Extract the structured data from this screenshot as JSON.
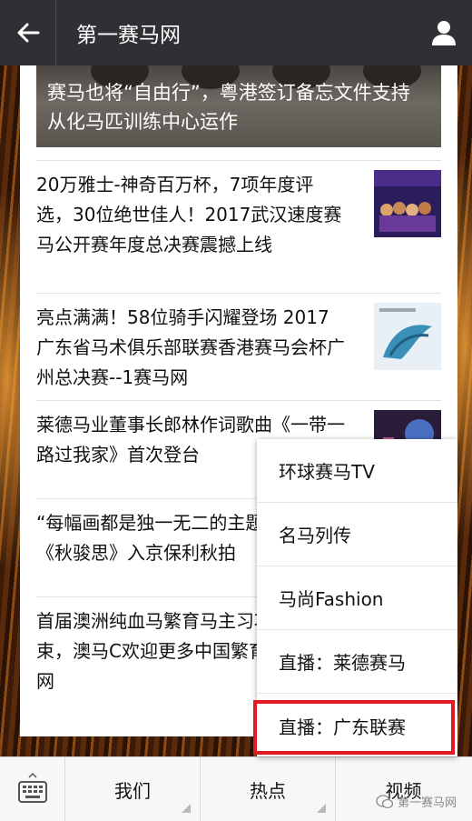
{
  "header": {
    "title": "第一赛马网"
  },
  "banner": {
    "caption": "赛马也将“自由行”，粤港签订备忘文件支持从化马匹训练中心运作"
  },
  "articles": [
    {
      "title": "20万雅士-神奇百万杯，7项年度评选，30位绝世佳人！2017武汉速度赛马公开赛年度总决赛震撼上线"
    },
    {
      "title": "亮点满满！58位骑手闪耀登场 2017广东省马术俱乐部联赛香港赛马会杯广州总决赛--1赛马网"
    },
    {
      "title": "莱德马业董事长郎林作词歌曲《一带一路过我家》首次登台"
    },
    {
      "title": "“每幅画都是独一无二的主题毛皮画《秋骏思》入京保利秋拍"
    },
    {
      "title": "首届澳洲纯血马繁育马主习项目圆满结束，澳马C欢迎更多中国繁育马主参马网"
    }
  ],
  "popup_menu": {
    "items": [
      "环球赛马TV",
      "名马列传",
      "马尚Fashion",
      "直播：莱德赛马",
      "直播：广东联赛"
    ]
  },
  "bottom_menu": {
    "items": [
      "我们",
      "热点",
      "视频"
    ]
  },
  "watermark": {
    "text": "第一赛马网"
  },
  "icons": {
    "back": "back-arrow-icon",
    "profile": "person-icon",
    "keyboard": "keyboard-icon",
    "watermark": "wechat-icon"
  },
  "colors": {
    "topbar": "#2f3033",
    "highlight": "#e01b24"
  }
}
